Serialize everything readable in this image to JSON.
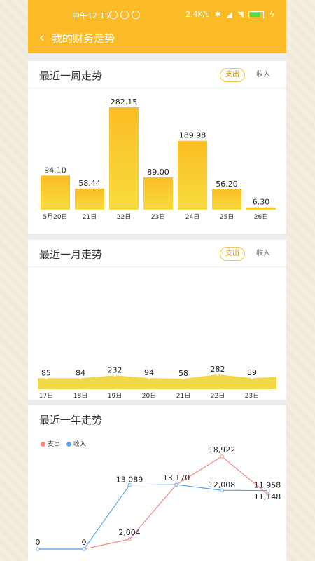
{
  "status_bar": {
    "time": "中午12:15",
    "speed": "2.4K/s"
  },
  "header": {
    "title": "我的财务走势"
  },
  "week": {
    "title": "最近一周走势",
    "toggle_expense": "支出",
    "toggle_income": "收入",
    "chart_data": {
      "type": "bar",
      "categories": [
        "5月20日",
        "21日",
        "22日",
        "23日",
        "24日",
        "25日",
        "26日"
      ],
      "values": [
        94.1,
        58.44,
        282.15,
        89.0,
        189.98,
        56.2,
        6.3
      ],
      "labels": [
        "94.10",
        "58.44",
        "282.15",
        "89.00",
        "189.98",
        "56.20",
        "6.30"
      ],
      "ylim": [
        0,
        282.15
      ],
      "colors": {
        "top": "#fbbd24",
        "bottom": "#f7dc3c"
      }
    }
  },
  "month": {
    "title": "最近一月走势",
    "toggle_expense": "支出",
    "toggle_income": "收入",
    "chart_data": {
      "type": "area",
      "categories": [
        "17日",
        "18日",
        "19日",
        "20日",
        "21日",
        "22日",
        "23日"
      ],
      "values": [
        85,
        84,
        232,
        94,
        58,
        282,
        89
      ],
      "labels": [
        "85",
        "84",
        "232",
        "94",
        "58",
        "282",
        "89"
      ],
      "colors": {
        "fill": "#f3d74b"
      }
    }
  },
  "year": {
    "title": "最近一年走势",
    "chart_data": {
      "type": "line",
      "series": [
        {
          "name": "支出",
          "color": "#f28b82",
          "values": [
            0,
            0,
            2004,
            13170,
            18922,
            11148
          ]
        },
        {
          "name": "收入",
          "color": "#5aa7f0",
          "values": [
            0,
            0,
            13089,
            13170,
            12008,
            11958
          ]
        }
      ],
      "labels": {
        "expense": [
          "0",
          "0",
          "2,004",
          "13,170",
          "18,922",
          "11,148"
        ],
        "income": [
          "",
          "",
          "13,089",
          "",
          "12,008",
          "11,958"
        ]
      },
      "legend": "top-left"
    }
  }
}
